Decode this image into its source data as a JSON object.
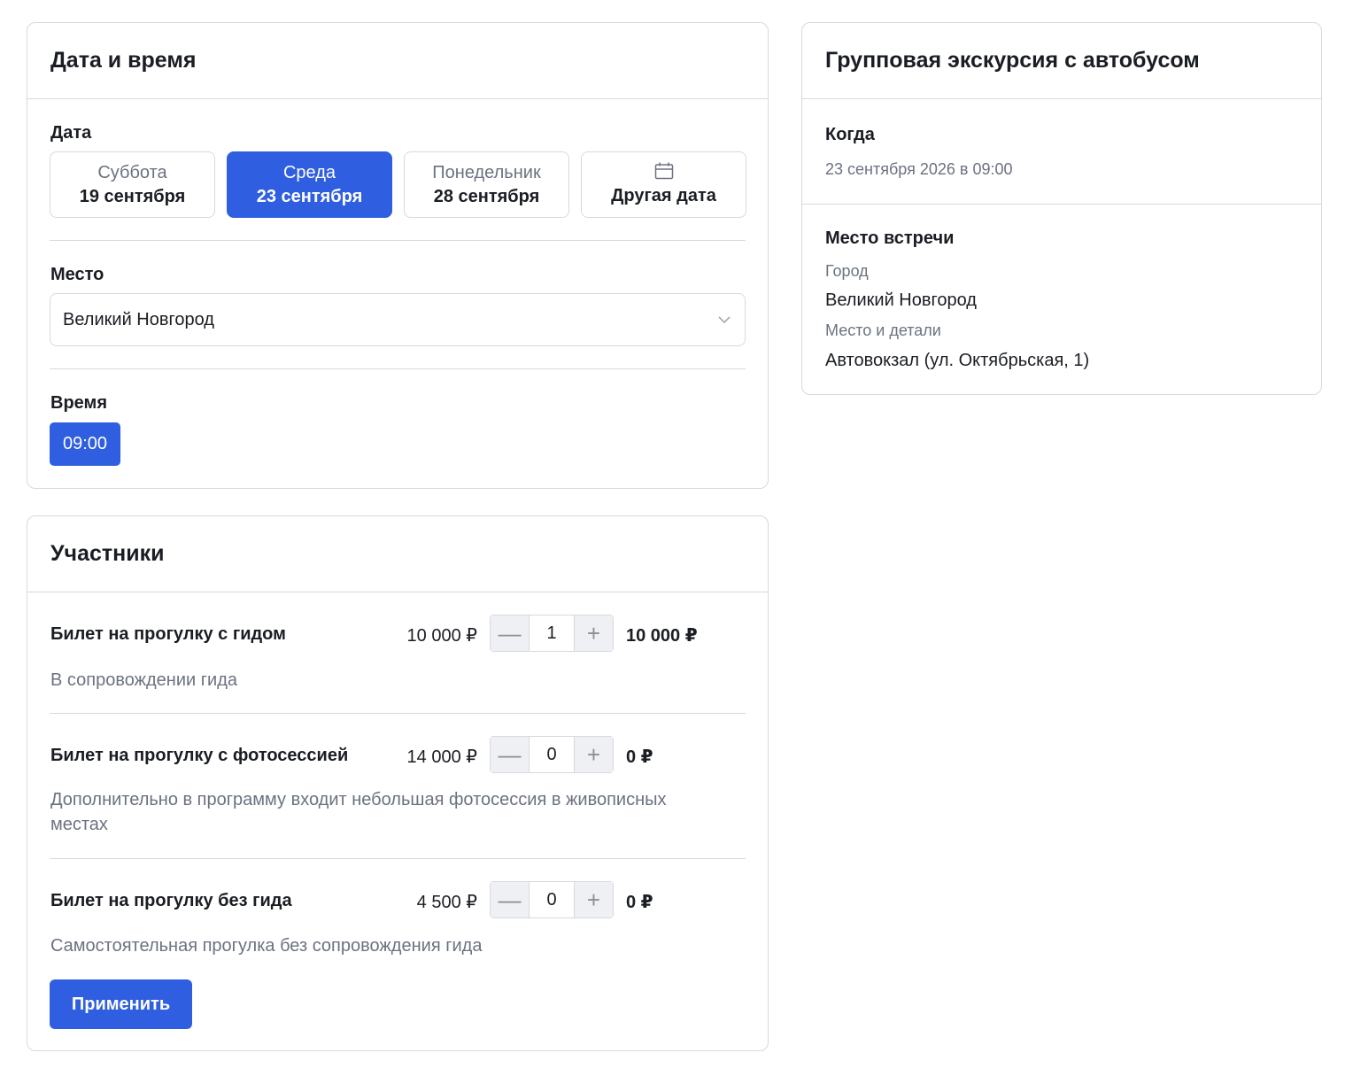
{
  "datetime": {
    "title": "Дата и время",
    "date_label": "Дата",
    "dates": [
      {
        "dow": "Суббота",
        "day": "19 сентября",
        "active": false
      },
      {
        "dow": "Среда",
        "day": "23 сентября",
        "active": true
      },
      {
        "dow": "Понедельник",
        "day": "28 сентября",
        "active": false
      }
    ],
    "other_date_label": "Другая дата",
    "place_label": "Место",
    "place_value": "Великий Новгород",
    "time_label": "Время",
    "time_value": "09:00"
  },
  "participants": {
    "title": "Участники",
    "tickets": [
      {
        "name": "Билет на прогулку с гидом",
        "price": "10 000 ₽",
        "qty": "1",
        "total": "10 000 ₽",
        "desc": "В сопровождении гида"
      },
      {
        "name": "Билет на прогулку с фотосессией",
        "price": "14 000 ₽",
        "qty": "0",
        "total": "0 ₽",
        "desc": "Дополнительно в программу входит небольшая фотосессия в живописных местах"
      },
      {
        "name": "Билет на прогулку без гида",
        "price": "4 500 ₽",
        "qty": "0",
        "total": "0 ₽",
        "desc": "Самостоятельная прогулка без сопровождения гида"
      }
    ],
    "minus_symbol": "—",
    "plus_symbol": "+",
    "apply_label": "Применить"
  },
  "summary": {
    "title": "Групповая экскурсия с автобусом",
    "when_label": "Когда",
    "when_value": "23 сентября 2026 в 09:00",
    "meeting_label": "Место встречи",
    "city_label": "Город",
    "city_value": "Великий Новгород",
    "details_label": "Место и детали",
    "details_value": "Автовокзал (ул. Октябрьская, 1)"
  },
  "colors": {
    "accent": "#2f5ee0",
    "border": "#d6d9df",
    "muted": "#6b7280"
  }
}
